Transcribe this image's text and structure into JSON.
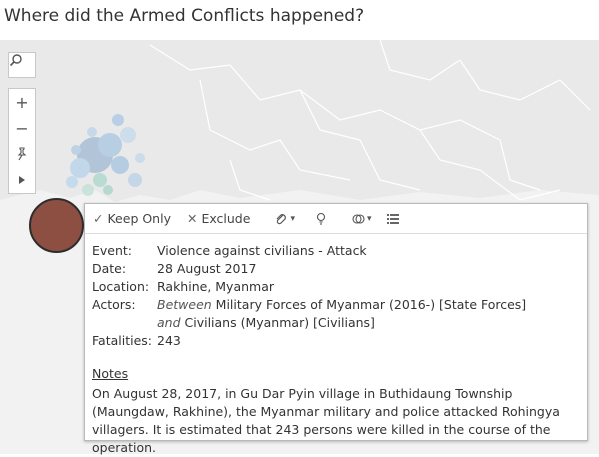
{
  "title": "Where did the Armed Conflicts happened?",
  "map_controls": {
    "search": "search-icon",
    "zoom_in": "+",
    "zoom_out": "−",
    "pin": "pin-icon",
    "expand": "expand-icon"
  },
  "marker_color": "#8c4f42",
  "tooltip": {
    "toolbar": {
      "keep_only": "Keep Only",
      "exclude": "Exclude"
    },
    "event_label": "Event:",
    "event_value": "Violence against civilians - Attack",
    "date_label": "Date:",
    "date_value": "28 August 2017",
    "location_label": "Location:",
    "location_value": "Rakhine, Myanmar",
    "actors_label": "Actors:",
    "actors_between": "Between",
    "actors_1": " Military Forces of Myanmar (2016-) [State Forces]",
    "actors_and": "and",
    "actors_2": " Civilians (Myanmar) [Civilians]",
    "fatalities_label": "Fatalities:",
    "fatalities_value": "243",
    "notes_heading": "Notes",
    "notes_text": "On August 28, 2017, in Gu Dar Pyin village in Buthidaung Township (Maungdaw, Rakhine), the Myanmar military and police attacked Rohingya villagers. It is estimated that 243 persons were killed in the course of the operation."
  }
}
